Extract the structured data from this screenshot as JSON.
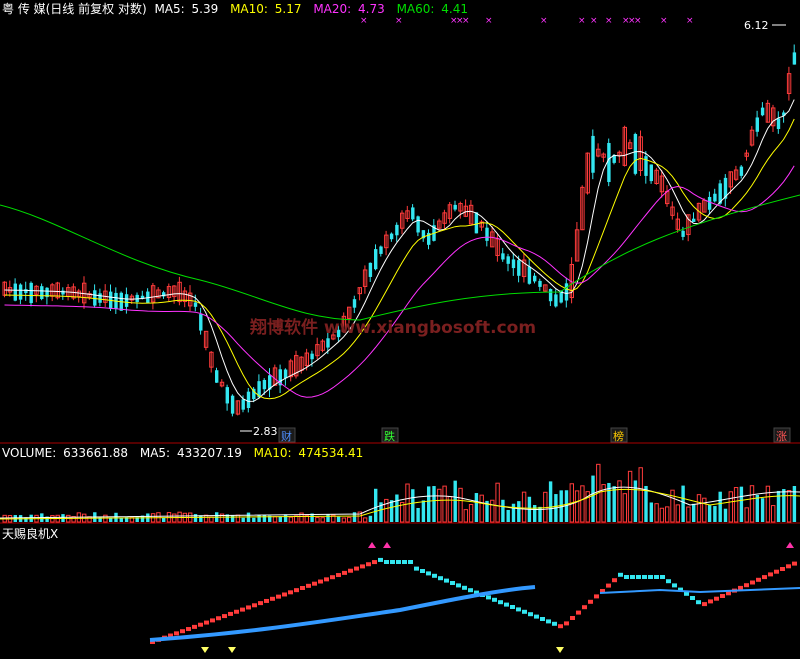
{
  "price_panel": {
    "title": "粤 传 媒(日线 前复权 对数)",
    "ma5_label": "MA5:",
    "ma5_value": "5.39",
    "ma10_label": "MA10:",
    "ma10_value": "5.17",
    "ma20_label": "MA20:",
    "ma20_value": "4.73",
    "ma60_label": "MA60:",
    "ma60_value": "4.41",
    "high_marker": "6.12",
    "low_marker": "2.83",
    "watermark": "翔博软件 www.xiangbosoft.com",
    "event_tags": [
      {
        "text": "财",
        "color": "#4f8fff"
      },
      {
        "text": "跌",
        "color": "#33ff33"
      },
      {
        "text": "榜",
        "color": "#ffcc00"
      },
      {
        "text": "涨",
        "color": "#ff5555"
      }
    ]
  },
  "volume_panel": {
    "volume_label": "VOLUME:",
    "volume_value": "633661.88",
    "ma5_label": "MA5:",
    "ma5_value": "433207.19",
    "ma10_label": "MA10:",
    "ma10_value": "474534.41"
  },
  "indicator_panel": {
    "title": "天赐良机X"
  },
  "colors": {
    "up": "#ff3b3b",
    "down": "#33e6f0",
    "ma5": "#ffffff",
    "ma10": "#ffff00",
    "ma20": "#ff33ff",
    "ma60": "#00dd00",
    "divider": "#aa0000",
    "blue_line": "#3399ff"
  }
}
